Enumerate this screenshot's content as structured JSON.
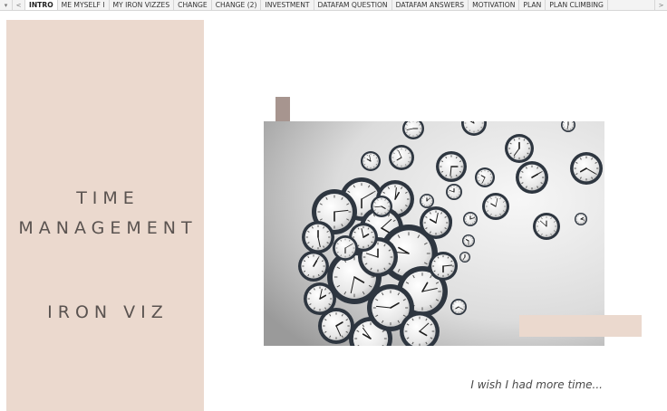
{
  "tab_bar": {
    "menu_glyph": "▾",
    "prev_glyph": "<",
    "next_glyph": ">",
    "tabs": [
      {
        "label": "INTRO",
        "active": true
      },
      {
        "label": "ME MYSELF I"
      },
      {
        "label": "MY IRON VIZZES"
      },
      {
        "label": "CHANGE"
      },
      {
        "label": "CHANGE (2)"
      },
      {
        "label": "INVESTMENT"
      },
      {
        "label": "DATAFAM QUESTION"
      },
      {
        "label": "DATAFAM ANSWERS"
      },
      {
        "label": "MOTIVATION"
      },
      {
        "label": "PLAN"
      },
      {
        "label": "PLAN CLIMBING"
      }
    ]
  },
  "panel": {
    "title_line1": "TIME",
    "title_line2": "MANAGEMENT",
    "subtitle": "IRON VIZ"
  },
  "image": {
    "subject": "clocks-forming-human-head-icon"
  },
  "caption": "I wish I had more time...",
  "colors": {
    "panel_bg": "#ebd9ce",
    "accent_bar": "#a7958f",
    "title_text": "#5a5350"
  }
}
